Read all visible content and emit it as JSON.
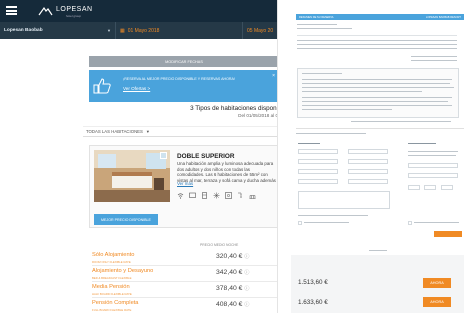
{
  "app": {
    "brand": "LOPESAN",
    "brand_sub": "hotel group"
  },
  "search": {
    "hotel": "Lopesan Baobab",
    "from_date": "01 Mayo 2018",
    "to_date": "05 Mayo 20"
  },
  "modify_button": "MODIFICAR FECHAS",
  "banner": {
    "text": "¡RESERVA AL MEJOR PRECIO DISPONIBLE Y RESERVAS AHORA!",
    "link": "Ver Ofertas >"
  },
  "results": {
    "title": "3 Tipos de habitaciones disponi",
    "date_range": "Del 01/05/2018 al 0",
    "sort_label": "TODAS LAS HABITACIONES"
  },
  "room": {
    "name": "DOBLE SUPERIOR",
    "description": "Una habitación amplia y luminosa adecuada para dos adultos y dos niños con todas las comodidades. Las 6 habitaciones de 55m² con vistas al mar, terraza y sofá cama y ducha además de una cama de matrimonio.",
    "more_link": "Ver más",
    "best_price_button": "MEJOR PRECIO DISPONIBLE",
    "price_column_label": "PRECIO MEDIO NOCHE"
  },
  "rates": [
    {
      "name": "Sólo Alojamiento",
      "sub": "ROOM ONLY FLEXIBLE RATE",
      "price": "320,40 €"
    },
    {
      "name": "Alojamiento y Desayuno",
      "sub": "BED & BREAKFAST FLEXIBLE",
      "price": "342,40 €"
    },
    {
      "name": "Media Pensión",
      "sub": "HALF BOARD FLEXIBLE RATE",
      "price": "378,40 €"
    },
    {
      "name": "Pensión Completa",
      "sub": "FULL BOARD FLEXIBLE RATE",
      "price": "408,40 €"
    }
  ],
  "summary": {
    "header_left": "RESUMEN DE SU RESERVA",
    "header_right": "LOPESAN BAOBAB RESORT",
    "totals": [
      "1.513,60 €",
      "1.633,60 €"
    ],
    "book_label": "AHORA"
  },
  "colors": {
    "navy": "#152a3a",
    "accent_blue": "#4aa3dc",
    "accent_orange": "#f08a24"
  }
}
